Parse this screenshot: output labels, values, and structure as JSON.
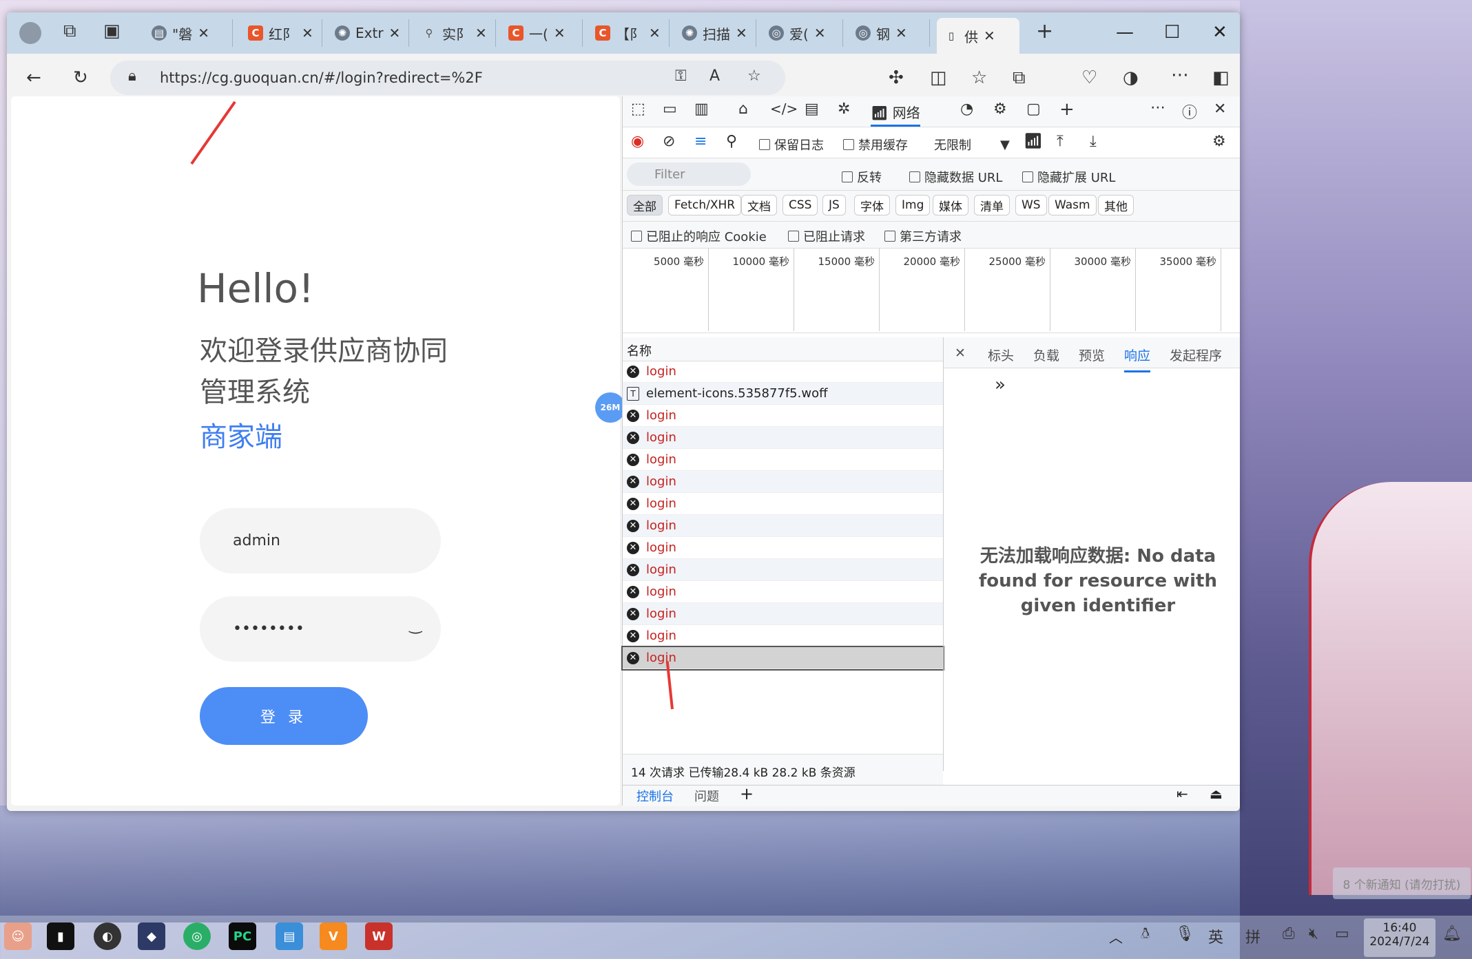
{
  "browser": {
    "tabs": [
      {
        "label": "\"磐",
        "icon": "page-icon"
      },
      {
        "label": "红阝",
        "icon": "c-icon"
      },
      {
        "label": "Extr",
        "icon": "openai-icon"
      },
      {
        "label": "实阝",
        "icon": "search-icon"
      },
      {
        "label": "一(",
        "icon": "c-icon"
      },
      {
        "label": "【阝",
        "icon": "c-icon"
      },
      {
        "label": "扫描",
        "icon": "openai-icon"
      },
      {
        "label": "爱(",
        "icon": "globe-icon"
      },
      {
        "label": "钢",
        "icon": "globe-icon"
      },
      {
        "label": "供",
        "icon": "page-icon"
      }
    ],
    "url": "https://cg.guoquan.cn/#/login?redirect=%2F"
  },
  "login_page": {
    "hello": "Hello!",
    "welcome": "欢迎登录供应商协同管理系统",
    "subtitle": "商家端",
    "username_value": "admin",
    "password_value": "••••••••",
    "login_button": "登 录",
    "memory_badge": "26M"
  },
  "devtools": {
    "toolbar_network_label": "网络",
    "preserve_log": "保留日志",
    "disable_cache": "禁用缓存",
    "throttle": "无限制",
    "filter_placeholder": "Filter",
    "invert": "反转",
    "hide_data_url": "隐藏数据 URL",
    "hide_ext_url": "隐藏扩展 URL",
    "type_filters": [
      "全部",
      "Fetch/XHR",
      "文档",
      "CSS",
      "JS",
      "字体",
      "Img",
      "媒体",
      "清单",
      "WS",
      "Wasm",
      "其他"
    ],
    "blocked_cookies": "已阻止的响应 Cookie",
    "blocked_requests": "已阻止请求",
    "third_party": "第三方请求",
    "timeline_ticks": [
      "5000 毫秒",
      "10000 毫秒",
      "15000 毫秒",
      "20000 毫秒",
      "25000 毫秒",
      "30000 毫秒",
      "35000 毫秒"
    ],
    "name_header": "名称",
    "requests": [
      {
        "name": "login",
        "status": "error"
      },
      {
        "name": "element-icons.535877f5.woff",
        "status": "ok"
      },
      {
        "name": "login",
        "status": "error"
      },
      {
        "name": "login",
        "status": "error"
      },
      {
        "name": "login",
        "status": "error"
      },
      {
        "name": "login",
        "status": "error"
      },
      {
        "name": "login",
        "status": "error"
      },
      {
        "name": "login",
        "status": "error"
      },
      {
        "name": "login",
        "status": "error"
      },
      {
        "name": "login",
        "status": "error"
      },
      {
        "name": "login",
        "status": "error"
      },
      {
        "name": "login",
        "status": "error"
      },
      {
        "name": "login",
        "status": "error"
      },
      {
        "name": "login",
        "status": "error"
      }
    ],
    "detail_tabs": [
      "标头",
      "负载",
      "预览",
      "响应",
      "发起程序"
    ],
    "active_detail_tab": "响应",
    "response_message": "无法加载响应数据: No data found for resource with given identifier",
    "summary": "14 次请求  已传输28.4 kB  28.2 kB 条资源",
    "drawer_tabs": [
      "控制台",
      "问题"
    ]
  },
  "desktop": {
    "notification": "8 个新通知 (请勿打扰)",
    "time": "16:40",
    "date": "2024/7/24",
    "ime_lang": "英",
    "ime_mode": "拼"
  },
  "colors": {
    "accent": "#3f7ef1",
    "login_button": "#4d8df6",
    "error_text": "#c5221f",
    "annotation_arrow": "#e53935"
  }
}
